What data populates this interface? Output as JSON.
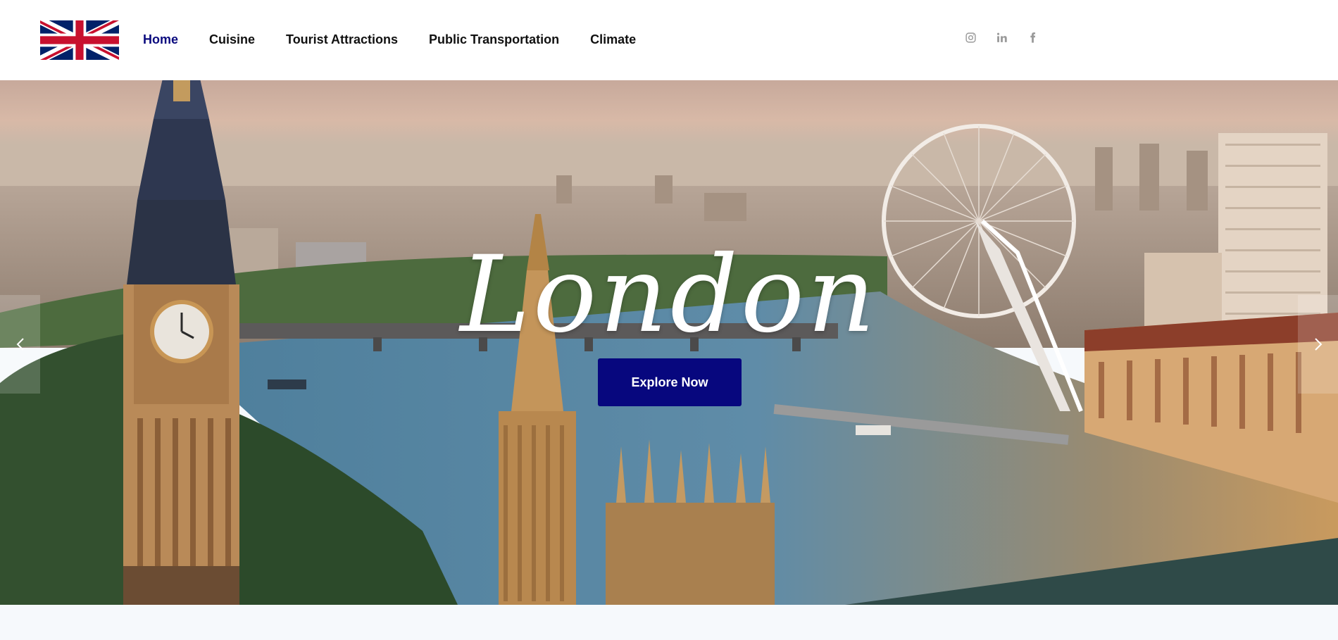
{
  "brand": {
    "logo_icon": "union-jack-flag-icon"
  },
  "nav": {
    "items": [
      {
        "label": "Home",
        "active": true
      },
      {
        "label": "Cuisine",
        "active": false
      },
      {
        "label": "Tourist Attractions",
        "active": false
      },
      {
        "label": "Public Transportation",
        "active": false
      },
      {
        "label": "Climate",
        "active": false
      }
    ]
  },
  "social": {
    "icons": [
      "instagram-icon",
      "linkedin-icon",
      "facebook-icon"
    ],
    "color": "#9a9a9a"
  },
  "hero": {
    "title": "London",
    "cta_label": "Explore Now",
    "cta_color": "#07077e",
    "prev_icon": "chevron-left-icon",
    "next_icon": "chevron-right-icon"
  },
  "colors": {
    "nav_active": "#0a0a7e",
    "nav_text": "#111111"
  }
}
